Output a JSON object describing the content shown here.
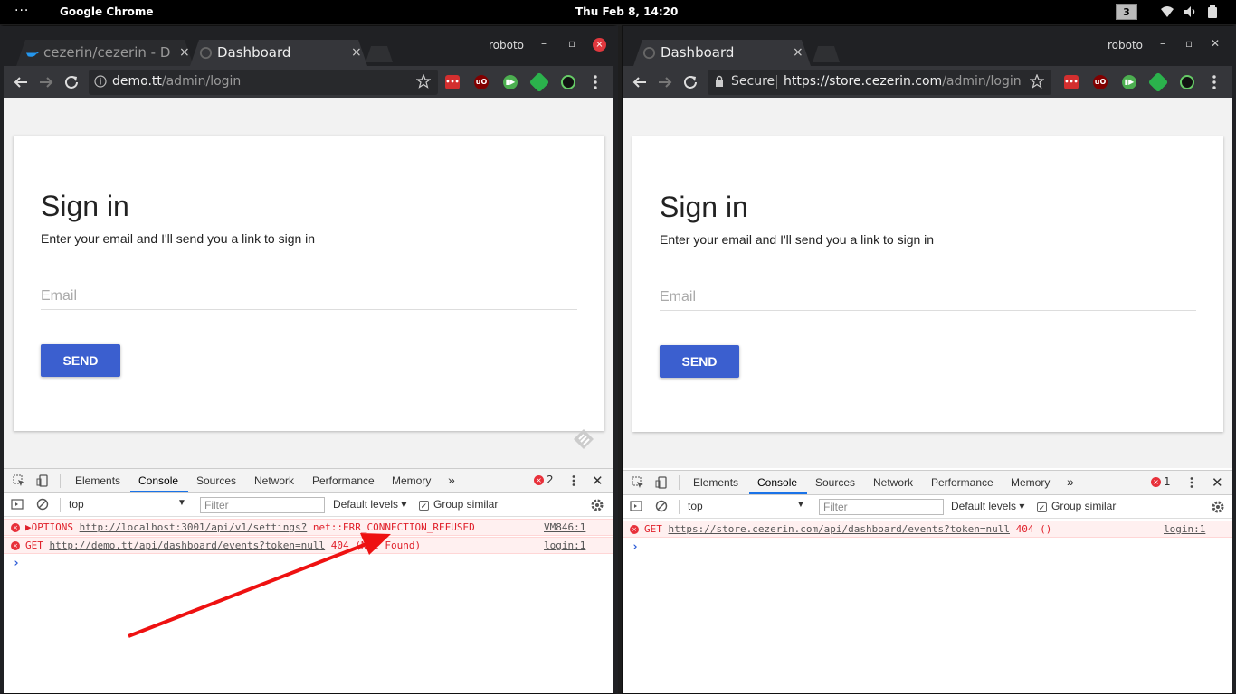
{
  "topbar": {
    "activities": "···",
    "app_name": "Google Chrome",
    "clock": "Thu Feb  8, 14:20",
    "workspace": "3"
  },
  "left": {
    "tabs": [
      {
        "label": "cezerin/cezerin - Do",
        "close": "×"
      },
      {
        "label": "Dashboard",
        "close": "×"
      }
    ],
    "profile": "roboto",
    "url": {
      "host": "demo.tt",
      "path": "/admin/login"
    },
    "extensions": [
      "ext-lastpass",
      "ext-ublock",
      "ext-pushbullet",
      "ext-feedly",
      "ext-speedometer"
    ],
    "page": {
      "title": "Sign in",
      "subtitle": "Enter your email and I'll send you a link to sign in",
      "email_placeholder": "Email",
      "send_label": "SEND"
    },
    "devtools": {
      "tabs": [
        "Elements",
        "Console",
        "Sources",
        "Network",
        "Performance",
        "Memory",
        "»"
      ],
      "error_count": "2",
      "error_badge": "×",
      "context": "top",
      "filter_placeholder": "Filter",
      "levels": "Default levels",
      "group_similar": "Group similar",
      "messages": [
        {
          "prefix": "▶OPTIONS ",
          "link": "http://localhost:3001/api/v1/settings?",
          "rest": " net::ERR_CONNECTION_REFUSED",
          "source": "VM846:1"
        },
        {
          "prefix": "GET ",
          "link": "http://demo.tt/api/dashboard/events?token=null",
          "rest": " 404 (Not Found)",
          "source": "login:1"
        }
      ],
      "prompt": "›"
    }
  },
  "right": {
    "tabs": [
      {
        "label": "Dashboard",
        "close": "×"
      }
    ],
    "profile": "roboto",
    "secure_label": "Secure",
    "url": {
      "host": "https://store.cezerin.com",
      "path": "/admin/login"
    },
    "page": {
      "title": "Sign in",
      "subtitle": "Enter your email and I'll send you a link to sign in",
      "email_placeholder": "Email",
      "send_label": "SEND"
    },
    "devtools": {
      "tabs": [
        "Elements",
        "Console",
        "Sources",
        "Network",
        "Performance",
        "Memory",
        "»"
      ],
      "error_count": "1",
      "error_badge": "×",
      "context": "top",
      "filter_placeholder": "Filter",
      "levels": "Default levels",
      "group_similar": "Group similar",
      "messages": [
        {
          "prefix": "GET ",
          "link": "https://store.cezerin.com/api/dashboard/events?token=null",
          "rest": " 404 ()",
          "source": "login:1"
        }
      ],
      "prompt": "›"
    }
  },
  "colors": {
    "accent_button": "#3b5fcf",
    "error_red": "#e0202a",
    "annotation_arrow": "#ee1111"
  }
}
